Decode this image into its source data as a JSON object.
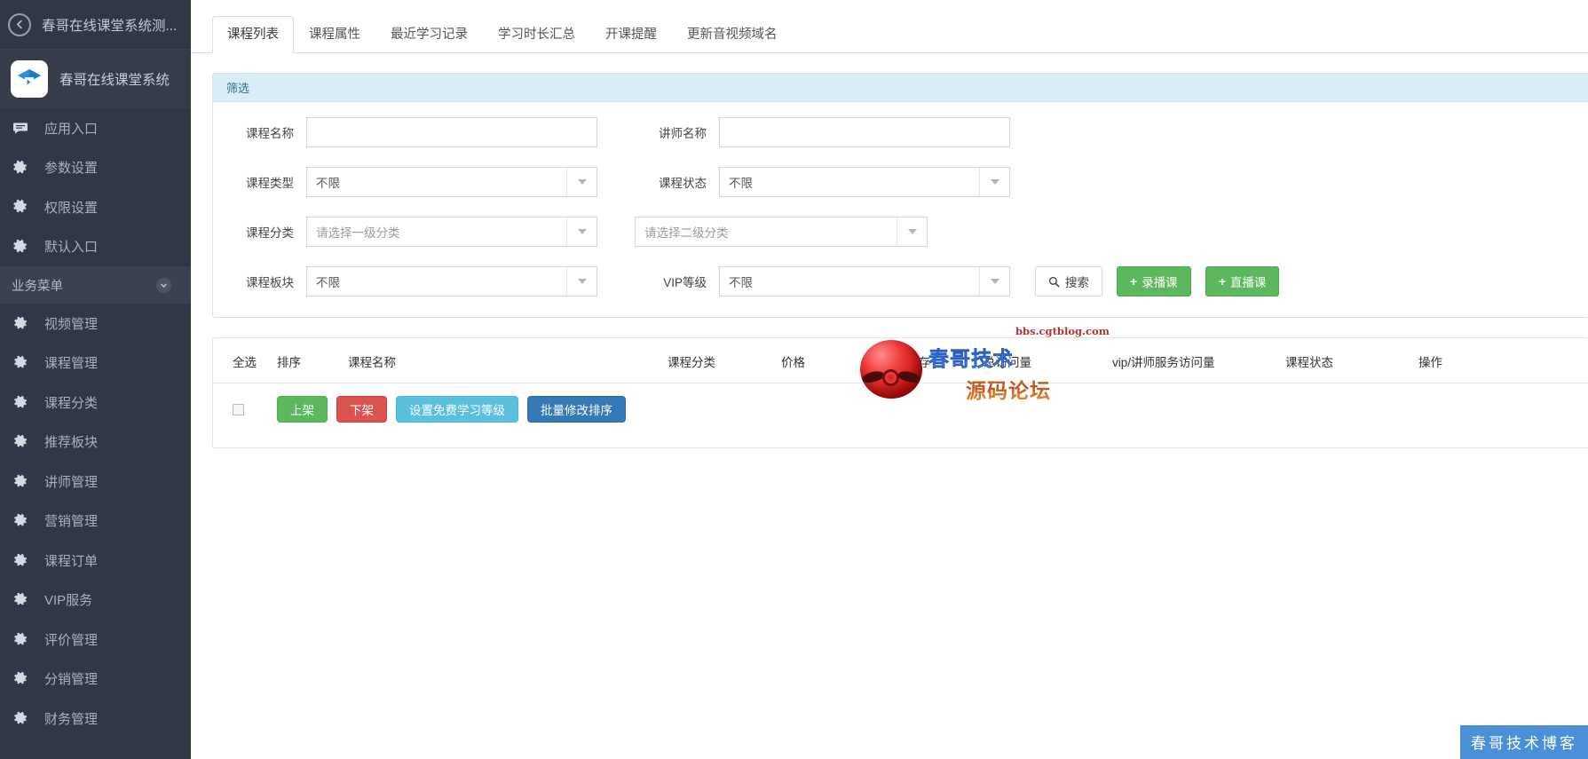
{
  "sidebar": {
    "back_title": "春哥在线课堂系统测...",
    "brand_title": "春哥在线课堂系统",
    "items": [
      {
        "label": "应用入口",
        "icon": "chat-icon"
      },
      {
        "label": "参数设置",
        "icon": "gear-icon"
      },
      {
        "label": "权限设置",
        "icon": "gear-icon"
      },
      {
        "label": "默认入口",
        "icon": "gear-icon"
      }
    ],
    "group_label": "业务菜单",
    "business_items": [
      {
        "label": "视频管理",
        "icon": "gear-icon"
      },
      {
        "label": "课程管理",
        "icon": "gear-icon"
      },
      {
        "label": "课程分类",
        "icon": "gear-icon"
      },
      {
        "label": "推荐板块",
        "icon": "gear-icon"
      },
      {
        "label": "讲师管理",
        "icon": "gear-icon"
      },
      {
        "label": "营销管理",
        "icon": "gear-icon"
      },
      {
        "label": "课程订单",
        "icon": "gear-icon"
      },
      {
        "label": "VIP服务",
        "icon": "gear-icon"
      },
      {
        "label": "评价管理",
        "icon": "gear-icon"
      },
      {
        "label": "分销管理",
        "icon": "gear-icon"
      },
      {
        "label": "财务管理",
        "icon": "gear-icon"
      }
    ]
  },
  "tabs": [
    {
      "label": "课程列表",
      "active": true
    },
    {
      "label": "课程属性",
      "active": false
    },
    {
      "label": "最近学习记录",
      "active": false
    },
    {
      "label": "学习时长汇总",
      "active": false
    },
    {
      "label": "开课提醒",
      "active": false
    },
    {
      "label": "更新音视频域名",
      "active": false
    }
  ],
  "filter": {
    "title": "筛选",
    "course_name_label": "课程名称",
    "course_name_value": "",
    "course_name_placeholder": "",
    "teacher_name_label": "讲师名称",
    "teacher_name_value": "",
    "teacher_name_placeholder": "",
    "course_type_label": "课程类型",
    "course_type_value": "不限",
    "course_status_label": "课程状态",
    "course_status_value": "不限",
    "course_category_label": "课程分类",
    "category_level1_value": "请选择一级分类",
    "category_level2_value": "请选择二级分类",
    "course_block_label": "课程板块",
    "course_block_value": "不限",
    "vip_level_label": "VIP等级",
    "vip_level_value": "不限",
    "search_button": "搜索",
    "search_icon": "search-icon",
    "add_recorded_button": "录播课",
    "add_live_button": "直播课",
    "accent_green": "#5cb85c",
    "panel_head_bg": "#d9edf7"
  },
  "table": {
    "headers": [
      "全选",
      "排序",
      "课程名称",
      "课程分类",
      "价格",
      "销量/库存",
      "总访问量",
      "vip/讲师服务访问量",
      "课程状态",
      "操作"
    ],
    "rows": [],
    "bulk_actions": [
      {
        "label": "上架",
        "color": "green"
      },
      {
        "label": "下架",
        "color": "red"
      },
      {
        "label": "设置免费学习等级",
        "color": "cyan"
      },
      {
        "label": "批量修改排序",
        "color": "blue"
      }
    ]
  },
  "watermark": {
    "line1": "春哥技术",
    "line2": "源码论坛",
    "url": "bbs.cgtblog.com",
    "corner": "春哥技术博客"
  }
}
